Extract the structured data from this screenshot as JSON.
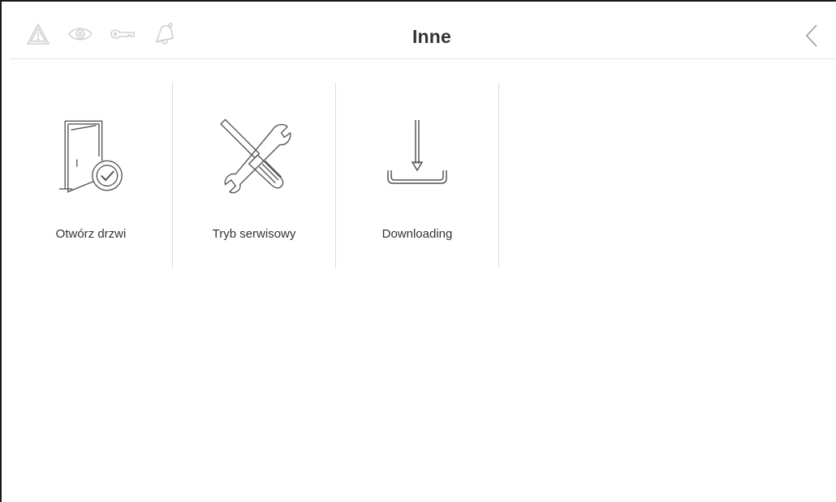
{
  "header": {
    "title": "Inne",
    "status_icons": [
      "warning-icon",
      "eye-icon",
      "key-icon",
      "bell-icon"
    ],
    "back_icon": "chevron-left-icon"
  },
  "tiles": [
    {
      "label": "Otwórz drzwi",
      "icon": "door-open-check-icon"
    },
    {
      "label": "Tryb serwisowy",
      "icon": "wrench-screwdriver-icon"
    },
    {
      "label": "Downloading",
      "icon": "download-icon"
    }
  ],
  "colors": {
    "title": "#333333",
    "status_icons": "#d0d0d0",
    "tile_icons": "#555555",
    "divider": "#dcdcdc"
  }
}
